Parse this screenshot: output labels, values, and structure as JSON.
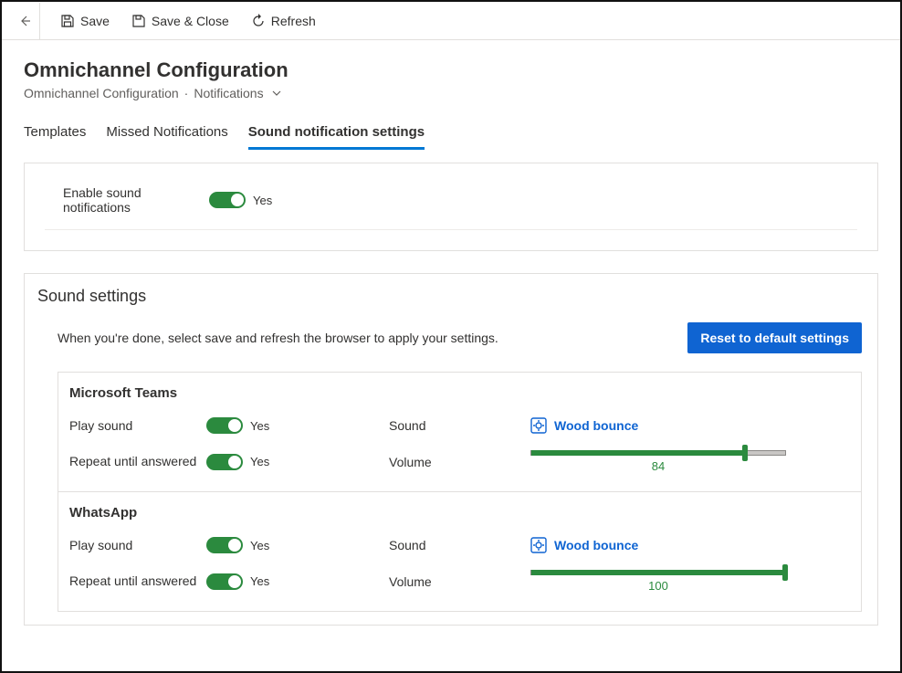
{
  "toolbar": {
    "save_label": "Save",
    "save_close_label": "Save & Close",
    "refresh_label": "Refresh"
  },
  "header": {
    "title": "Omnichannel Configuration",
    "breadcrumb_root": "Omnichannel Configuration",
    "breadcrumb_leaf": "Notifications"
  },
  "tabs": {
    "templates": "Templates",
    "missed": "Missed Notifications",
    "sound": "Sound notification settings"
  },
  "enable_panel": {
    "label": "Enable sound notifications",
    "value_label": "Yes"
  },
  "sound_section": {
    "title": "Sound settings",
    "help": "When you're done, select save and refresh the browser to apply your settings.",
    "reset_button": "Reset to default settings",
    "labels": {
      "play_sound": "Play sound",
      "repeat": "Repeat until answered",
      "sound": "Sound",
      "volume": "Volume",
      "yes": "Yes"
    },
    "channels": [
      {
        "name": "Microsoft Teams",
        "play_sound": true,
        "repeat": true,
        "sound_name": "Wood bounce",
        "volume": 84
      },
      {
        "name": "WhatsApp",
        "play_sound": true,
        "repeat": true,
        "sound_name": "Wood bounce",
        "volume": 100
      }
    ]
  }
}
